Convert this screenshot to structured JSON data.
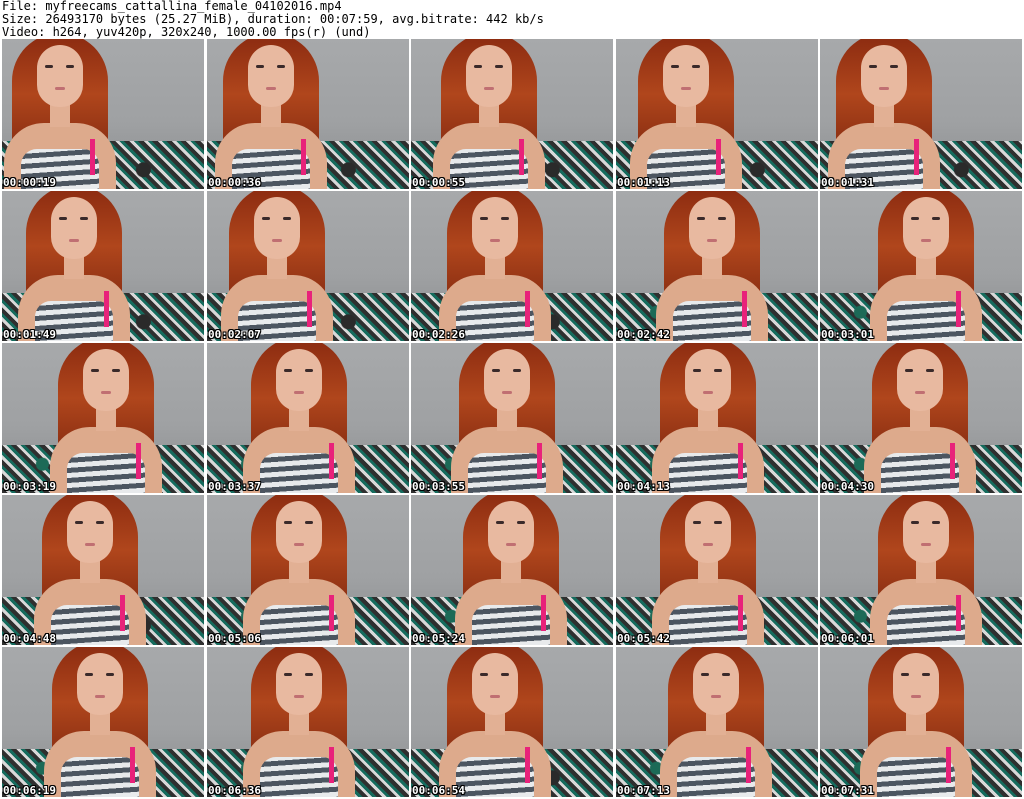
{
  "header": {
    "file_line": "File: myfreecams_cattallina_female_04102016.mp4",
    "size_line": "Size: 26493170 bytes (25.27 MiB), duration: 00:07:59, avg.bitrate: 442 kb/s",
    "video_line": "Video: h264, yuv420p, 320x240, 1000.00 fps(r) (und)"
  },
  "thumbnails": [
    {
      "timestamp": "00:00:19"
    },
    {
      "timestamp": "00:00:36"
    },
    {
      "timestamp": "00:00:55"
    },
    {
      "timestamp": "00:01:13"
    },
    {
      "timestamp": "00:01:31"
    },
    {
      "timestamp": "00:01:49"
    },
    {
      "timestamp": "00:02:07"
    },
    {
      "timestamp": "00:02:26"
    },
    {
      "timestamp": "00:02:42"
    },
    {
      "timestamp": "00:03:01"
    },
    {
      "timestamp": "00:03:19"
    },
    {
      "timestamp": "00:03:37"
    },
    {
      "timestamp": "00:03:55"
    },
    {
      "timestamp": "00:04:13"
    },
    {
      "timestamp": "00:04:30"
    },
    {
      "timestamp": "00:04:48"
    },
    {
      "timestamp": "00:05:06"
    },
    {
      "timestamp": "00:05:24"
    },
    {
      "timestamp": "00:05:42"
    },
    {
      "timestamp": "00:06:01"
    },
    {
      "timestamp": "00:06:19"
    },
    {
      "timestamp": "00:06:36"
    },
    {
      "timestamp": "00:06:54"
    },
    {
      "timestamp": "00:07:13"
    },
    {
      "timestamp": "00:07:31"
    }
  ],
  "colors": {
    "background": "#ffffff",
    "timestamp_text": "#ffffff",
    "timestamp_outline": "#000000",
    "hair": "#b0461c",
    "strap": "#e8227a",
    "bedding": "#156b5d"
  }
}
